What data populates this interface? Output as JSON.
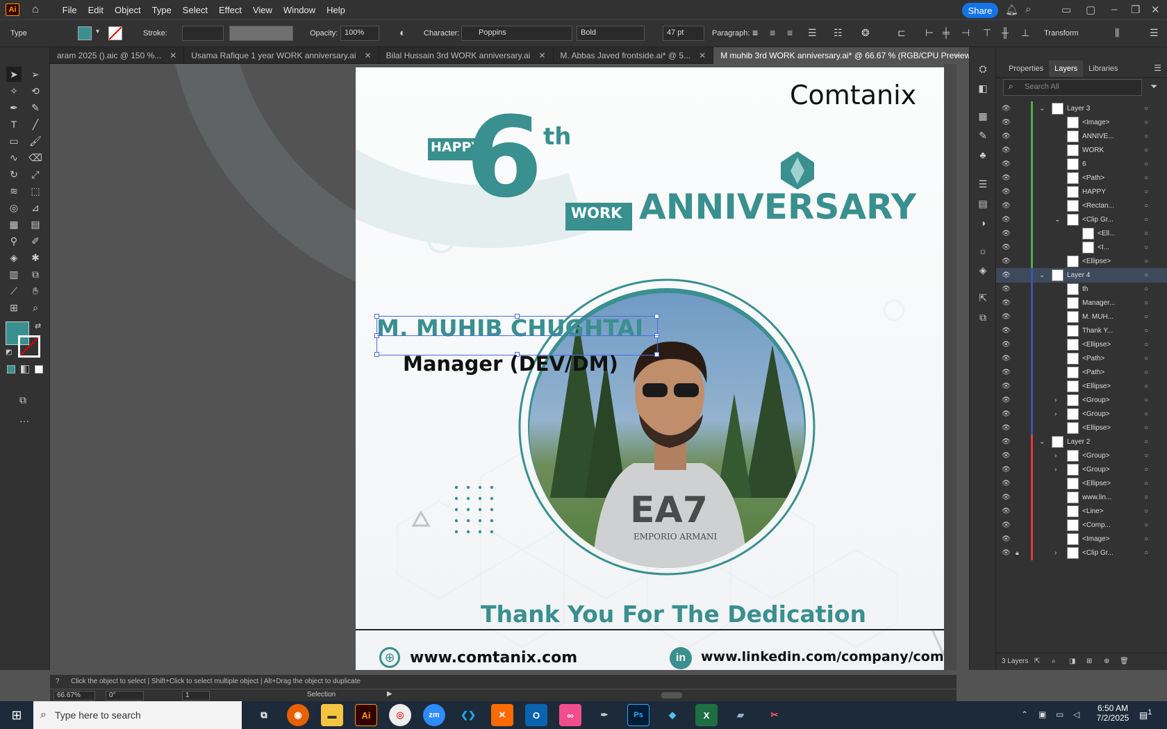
{
  "app": {
    "logo": "Ai",
    "share_label": "Share"
  },
  "menu": [
    "File",
    "Edit",
    "Object",
    "Type",
    "Select",
    "Effect",
    "View",
    "Window",
    "Help"
  ],
  "control_bar": {
    "type_label": "Type",
    "stroke_label": "Stroke:",
    "opacity_label": "Opacity:",
    "opacity_value": "100%",
    "character_label": "Character:",
    "font_family": "Poppins",
    "font_style": "Bold",
    "font_size": "47 pt",
    "paragraph_label": "Paragraph:",
    "transform_label": "Transform",
    "fill_color": "#3a8f8f"
  },
  "tabs": [
    {
      "label": "aram 2025 ().aic @ 150 %...",
      "active": false
    },
    {
      "label": "Usama Rafique 1 year WORK anniversary.ai",
      "active": false
    },
    {
      "label": "Bilal Hussain  3rd  WORK anniversary.ai",
      "active": false
    },
    {
      "label": "M. Abbas Javed  frontside.ai* @ 5...",
      "active": false
    },
    {
      "label": "M muhib 3rd  WORK anniversary.ai* @ 66.67 % (RGB/CPU Preview)",
      "active": true
    }
  ],
  "artboard": {
    "brand": "Comtanix",
    "happy": "HAPPY",
    "number": "6",
    "ordinal": "th",
    "work": "WORK",
    "anniversary": "ANNIVERSARY",
    "name": "M. MUHIB CHUGHTAI",
    "role": "Manager (DEV/DM)",
    "thanks": "Thank You For The Dedication",
    "website": "www.comtanix.com",
    "linkedin": "www.linkedin.com/company/comtanix",
    "teal": "#3a8f8f"
  },
  "panel": {
    "tabs": [
      "Properties",
      "Layers",
      "Libraries"
    ],
    "search_placeholder": "Search All",
    "layers": [
      {
        "name": "Layer 3",
        "indent": 0,
        "color": "#4caf50",
        "expand": "down",
        "layer": true
      },
      {
        "name": "<Image>",
        "indent": 1,
        "color": "#4caf50"
      },
      {
        "name": "ANNIVE...",
        "indent": 1,
        "color": "#4caf50"
      },
      {
        "name": "WORK",
        "indent": 1,
        "color": "#4caf50"
      },
      {
        "name": "6",
        "indent": 1,
        "color": "#4caf50"
      },
      {
        "name": "<Path>",
        "indent": 1,
        "color": "#4caf50"
      },
      {
        "name": "HAPPY",
        "indent": 1,
        "color": "#4caf50"
      },
      {
        "name": "<Rectan...",
        "indent": 1,
        "color": "#4caf50"
      },
      {
        "name": "<Clip Gr...",
        "indent": 1,
        "color": "#4caf50",
        "expand": "down"
      },
      {
        "name": "<Ell...",
        "indent": 2,
        "color": "#4caf50"
      },
      {
        "name": "<I...",
        "indent": 2,
        "color": "#4caf50"
      },
      {
        "name": "<Ellipse>",
        "indent": 1,
        "color": "#4caf50"
      },
      {
        "name": "Layer 4",
        "indent": 0,
        "color": "#3f51b5",
        "expand": "down",
        "layer": true,
        "selected": true
      },
      {
        "name": "th",
        "indent": 1,
        "color": "#3f51b5"
      },
      {
        "name": "Manager...",
        "indent": 1,
        "color": "#3f51b5"
      },
      {
        "name": "M. MUH...",
        "indent": 1,
        "color": "#3f51b5"
      },
      {
        "name": "Thank Y...",
        "indent": 1,
        "color": "#3f51b5"
      },
      {
        "name": "<Ellipse>",
        "indent": 1,
        "color": "#3f51b5"
      },
      {
        "name": "<Path>",
        "indent": 1,
        "color": "#3f51b5"
      },
      {
        "name": "<Path>",
        "indent": 1,
        "color": "#3f51b5"
      },
      {
        "name": "<Ellipse>",
        "indent": 1,
        "color": "#3f51b5"
      },
      {
        "name": "<Group>",
        "indent": 1,
        "color": "#3f51b5",
        "expand": "right"
      },
      {
        "name": "<Group>",
        "indent": 1,
        "color": "#3f51b5",
        "expand": "right"
      },
      {
        "name": "<Ellipse>",
        "indent": 1,
        "color": "#3f51b5"
      },
      {
        "name": "Layer 2",
        "indent": 0,
        "color": "#e53935",
        "expand": "down",
        "layer": true
      },
      {
        "name": "<Group>",
        "indent": 1,
        "color": "#e53935",
        "expand": "right"
      },
      {
        "name": "<Group>",
        "indent": 1,
        "color": "#e53935",
        "expand": "right"
      },
      {
        "name": "<Ellipse>",
        "indent": 1,
        "color": "#e53935"
      },
      {
        "name": "www.lin...",
        "indent": 1,
        "color": "#e53935"
      },
      {
        "name": "<Line>",
        "indent": 1,
        "color": "#e53935"
      },
      {
        "name": "<Comp...",
        "indent": 1,
        "color": "#e53935"
      },
      {
        "name": "<Image>",
        "indent": 1,
        "color": "#e53935"
      },
      {
        "name": "<Clip Gr...",
        "indent": 1,
        "color": "#e53935",
        "expand": "right",
        "locked": true
      }
    ],
    "footer": "3 Layers"
  },
  "status": {
    "hint": "Click the object to select  |  Shift+Click to select multiple object  |  Alt+Drag the object to duplicate",
    "zoom": "66.67%",
    "rotation": "0°",
    "artboard_num": "1",
    "tool": "Selection"
  },
  "taskbar": {
    "search_placeholder": "Type here to search",
    "time": "6:50 AM",
    "date": "7/2/2025",
    "notif": "1"
  }
}
